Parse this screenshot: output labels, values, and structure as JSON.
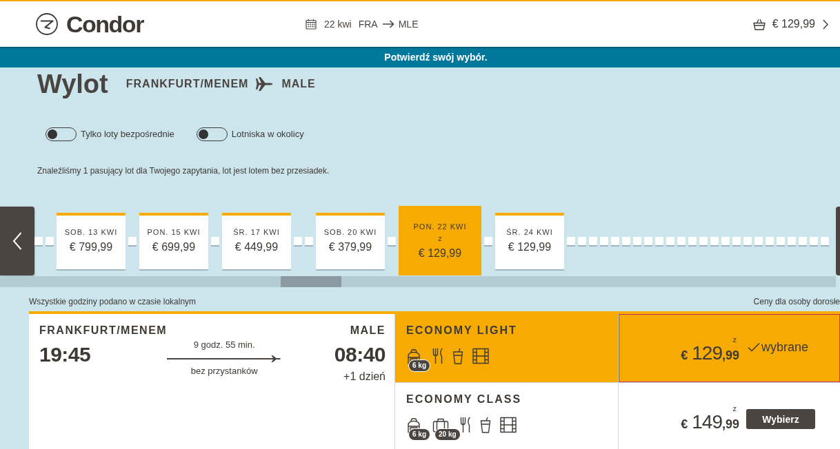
{
  "header": {
    "logo": "Condor",
    "trip": {
      "date": "22 kwi",
      "origin": "FRA",
      "destination": "MLE"
    },
    "basket_total": "€ 129,99"
  },
  "banner": "Potwierdź swój wybór.",
  "heading": {
    "title": "Wylot",
    "origin": "FRANKFURT/MENEM",
    "destination": "MALE"
  },
  "filters": [
    {
      "label": "Tylko loty bezpośrednie",
      "on": false
    },
    {
      "label": "Lotniska w okolicy",
      "on": false
    }
  ],
  "results_message": "Znaleźliśmy 1 pasujący lot dla Twojego zapytania, lot jest lotem bez przesiadek.",
  "date_carousel": {
    "days": [
      {
        "kind": "empty"
      },
      {
        "kind": "empty"
      },
      {
        "kind": "flight",
        "date": "SOB. 13 KWI",
        "price": "€ 799,99",
        "selected": false
      },
      {
        "kind": "empty"
      },
      {
        "kind": "flight",
        "date": "PON. 15 KWI",
        "price": "€ 699,99",
        "selected": false
      },
      {
        "kind": "empty"
      },
      {
        "kind": "flight",
        "date": "ŚR. 17 KWI",
        "price": "€ 449,99",
        "selected": false
      },
      {
        "kind": "empty"
      },
      {
        "kind": "empty"
      },
      {
        "kind": "flight",
        "date": "SOB. 20 KWI",
        "price": "€ 379,99",
        "selected": false
      },
      {
        "kind": "empty"
      },
      {
        "kind": "flight",
        "date": "PON. 22 KWI",
        "price_prefix": "z",
        "price": "€ 129,99",
        "selected": true
      },
      {
        "kind": "empty"
      },
      {
        "kind": "flight",
        "date": "ŚR. 24 KWI",
        "price": "€ 129,99",
        "selected": false
      },
      {
        "kind": "empty"
      },
      {
        "kind": "empty"
      },
      {
        "kind": "empty"
      },
      {
        "kind": "empty"
      },
      {
        "kind": "empty"
      },
      {
        "kind": "empty"
      },
      {
        "kind": "empty"
      },
      {
        "kind": "empty"
      },
      {
        "kind": "empty"
      },
      {
        "kind": "empty"
      },
      {
        "kind": "empty"
      },
      {
        "kind": "empty"
      },
      {
        "kind": "empty"
      },
      {
        "kind": "empty"
      },
      {
        "kind": "empty"
      },
      {
        "kind": "empty"
      },
      {
        "kind": "empty"
      },
      {
        "kind": "empty"
      },
      {
        "kind": "empty"
      },
      {
        "kind": "empty"
      },
      {
        "kind": "empty"
      },
      {
        "kind": "empty"
      },
      {
        "kind": "empty"
      },
      {
        "kind": "empty"
      }
    ]
  },
  "notes": {
    "times": "Wszystkie godziny podano w czasie lokalnym",
    "prices": "Ceny dla osoby dorosłe"
  },
  "flight": {
    "origin": "FRANKFURT/MENEM",
    "departure": "19:45",
    "duration": "9 godz. 55 min.",
    "stops": "bez przystanków",
    "destination": "MALE",
    "arrival": "08:40",
    "day_offset": "+1 dzień"
  },
  "fares": [
    {
      "name": "ECONOMY LIGHT",
      "selected": true,
      "amenities": [
        {
          "kind": "backpack",
          "weight": "6 kg"
        },
        {
          "kind": "meal"
        },
        {
          "kind": "drink"
        },
        {
          "kind": "entertainment"
        }
      ],
      "price_prefix": "z",
      "currency": "€",
      "price_main": "129",
      "price_cents": ",99",
      "action": "wybrane"
    },
    {
      "name": "ECONOMY CLASS",
      "selected": false,
      "amenities": [
        {
          "kind": "backpack",
          "weight": "6 kg"
        },
        {
          "kind": "suitcase",
          "weight": "20 kg"
        },
        {
          "kind": "meal"
        },
        {
          "kind": "drink"
        },
        {
          "kind": "entertainment"
        }
      ],
      "price_prefix": "z",
      "currency": "€",
      "price_main": "149",
      "price_cents": ",99",
      "action": "Wybierz"
    }
  ]
}
